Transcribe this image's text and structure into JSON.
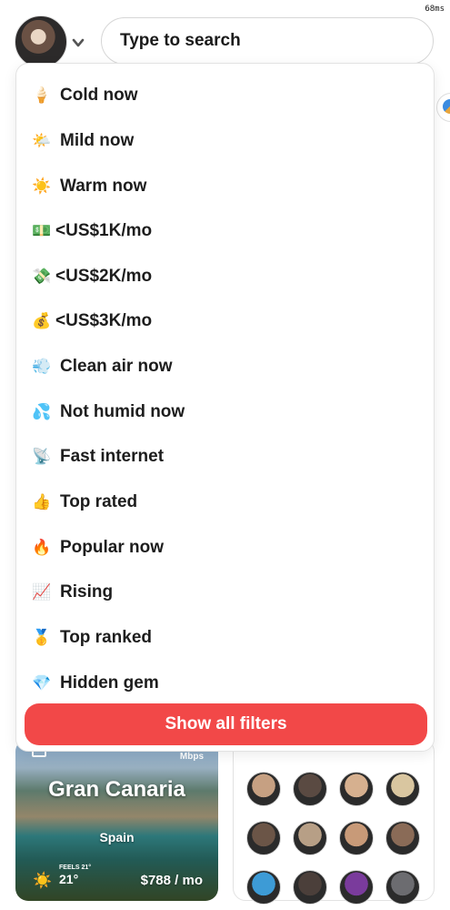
{
  "perf_label": "68ms",
  "search": {
    "placeholder": "Type to search"
  },
  "filters": [
    {
      "emoji": "🍦",
      "label": "Cold now"
    },
    {
      "emoji": "🌤️",
      "label": "Mild now"
    },
    {
      "emoji": "☀️",
      "label": "Warm now"
    },
    {
      "emoji": "💵",
      "label": "<US$1K/mo"
    },
    {
      "emoji": "💸",
      "label": "<US$2K/mo"
    },
    {
      "emoji": "💰",
      "label": "<US$3K/mo"
    },
    {
      "emoji": "💨",
      "label": "Clean air now"
    },
    {
      "emoji": "💦",
      "label": "Not humid now"
    },
    {
      "emoji": "📡",
      "label": "Fast internet"
    },
    {
      "emoji": "👍",
      "label": "Top rated"
    },
    {
      "emoji": "🔥",
      "label": "Popular now"
    },
    {
      "emoji": "📈",
      "label": "Rising"
    },
    {
      "emoji": "🥇",
      "label": "Top ranked"
    },
    {
      "emoji": "💎",
      "label": "Hidden gem"
    }
  ],
  "show_all_label": "Show all filters",
  "city_card": {
    "speed_unit": "Mbps",
    "name": "Gran Canaria",
    "country": "Spain",
    "weather_icon": "☀️",
    "feels_label": "FEELS 21°",
    "temperature": "21°",
    "cost": "$788 / mo"
  },
  "colors": {
    "accent": "#f24848",
    "border": "#e2e2e2"
  },
  "people_avatars": [
    "#c6a082",
    "#5a4a42",
    "#d6b08f",
    "#d9c6a0",
    "#6b5547",
    "#b79f86",
    "#c89a78",
    "#8a6b57",
    "#3d9bd6",
    "#4b3f3a",
    "#7a3b9c",
    "#6c6c70"
  ]
}
